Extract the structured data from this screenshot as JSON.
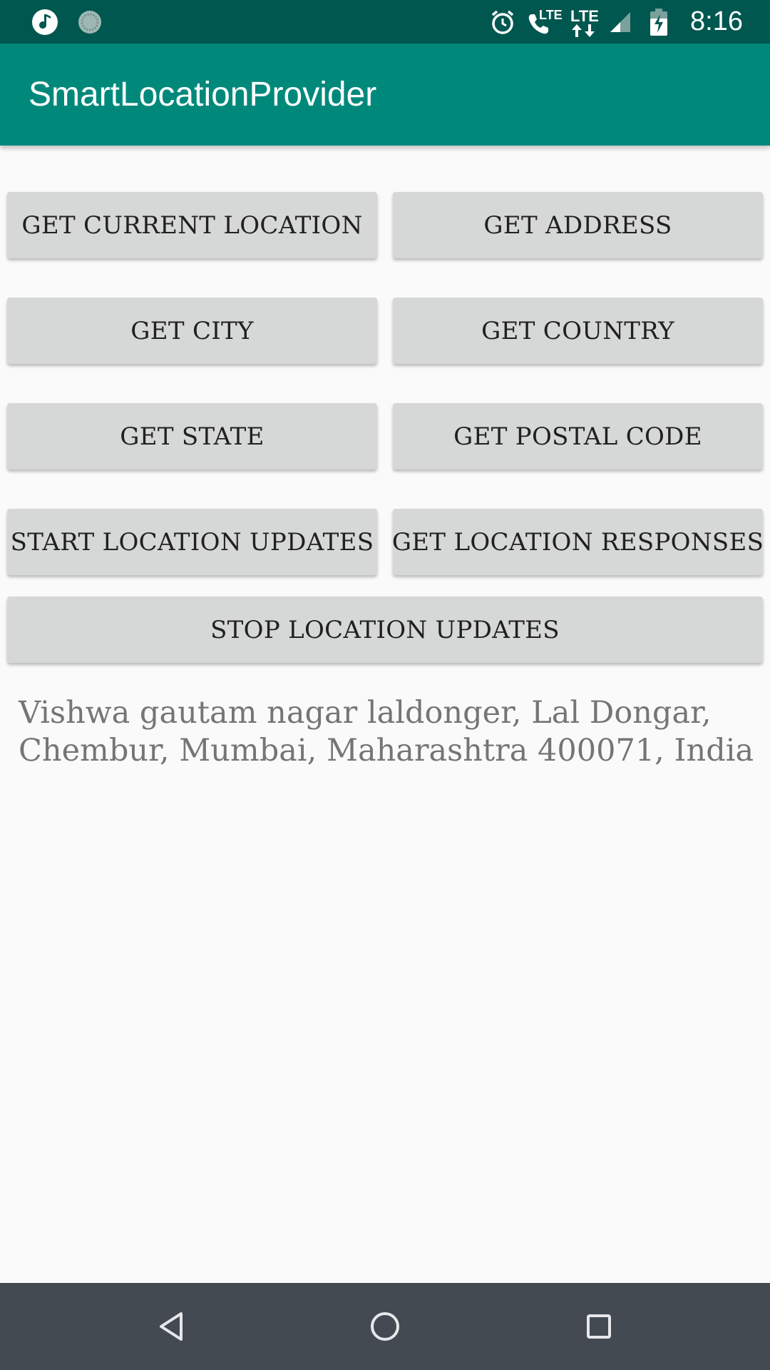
{
  "status_bar": {
    "time": "8:16",
    "left_icons": [
      "music-note-icon",
      "sync-circle-icon"
    ],
    "right_icons": [
      "alarm-icon",
      "volte-call-icon",
      "lte-data-icon",
      "signal-icon",
      "battery-charging-icon"
    ],
    "call_lte_label": "LTE",
    "data_lte_label": "LTE"
  },
  "app_bar": {
    "title": "SmartLocationProvider",
    "color": "#00897b"
  },
  "buttons": {
    "get_current_location": "GET CURRENT LOCATION",
    "get_address": "GET ADDRESS",
    "get_city": "GET CITY",
    "get_country": "GET COUNTRY",
    "get_state": "GET STATE",
    "get_postal_code": "GET POSTAL CODE",
    "start_location_updates": "START LOCATION UPDATES",
    "get_location_responses": "GET LOCATION RESPONSES",
    "stop_location_updates": "STOP LOCATION UPDATES"
  },
  "result": {
    "text": "Vishwa gautam nagar laldonger, Lal Dongar, Chembur, Mumbai, Maharashtra 400071, India"
  },
  "nav_bar": {
    "icons": [
      "back-icon",
      "home-icon",
      "recents-icon"
    ]
  },
  "colors": {
    "status_bar": "#00574f",
    "app_bar": "#00897b",
    "button_bg": "#d6d7d7",
    "nav_bar": "#444a52"
  }
}
